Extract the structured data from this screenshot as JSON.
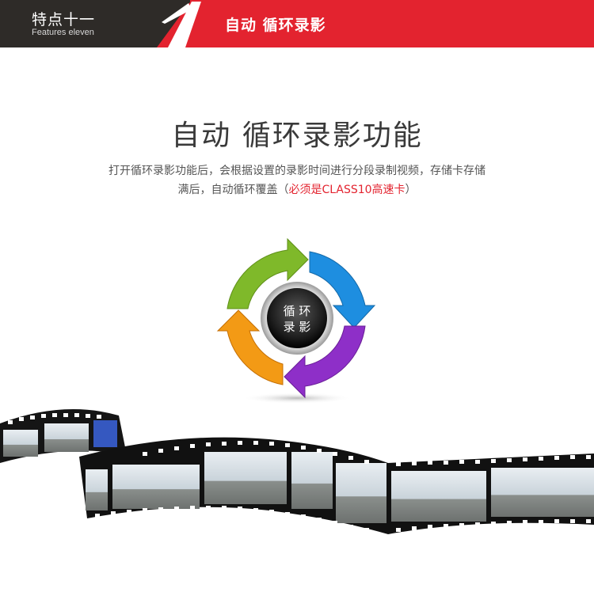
{
  "header": {
    "feature_cn": "特点十一",
    "feature_en": "Features eleven",
    "title": "自动  循环录影"
  },
  "main": {
    "title": "自动 循环录影功能",
    "desc_line1": "打开循环录影功能后，会根据设置的录影时间进行分段录制视频，存储卡存储",
    "desc_line2_a": "满后，自动循环覆盖（",
    "desc_line2_red": "必须是CLASS10高速卡",
    "desc_line2_b": "）"
  },
  "cycle": {
    "center_line1": "循 环",
    "center_line2": "录 影"
  },
  "colors": {
    "dark": "#2e2b28",
    "red": "#e3232f",
    "text": "#3a3a3a"
  }
}
